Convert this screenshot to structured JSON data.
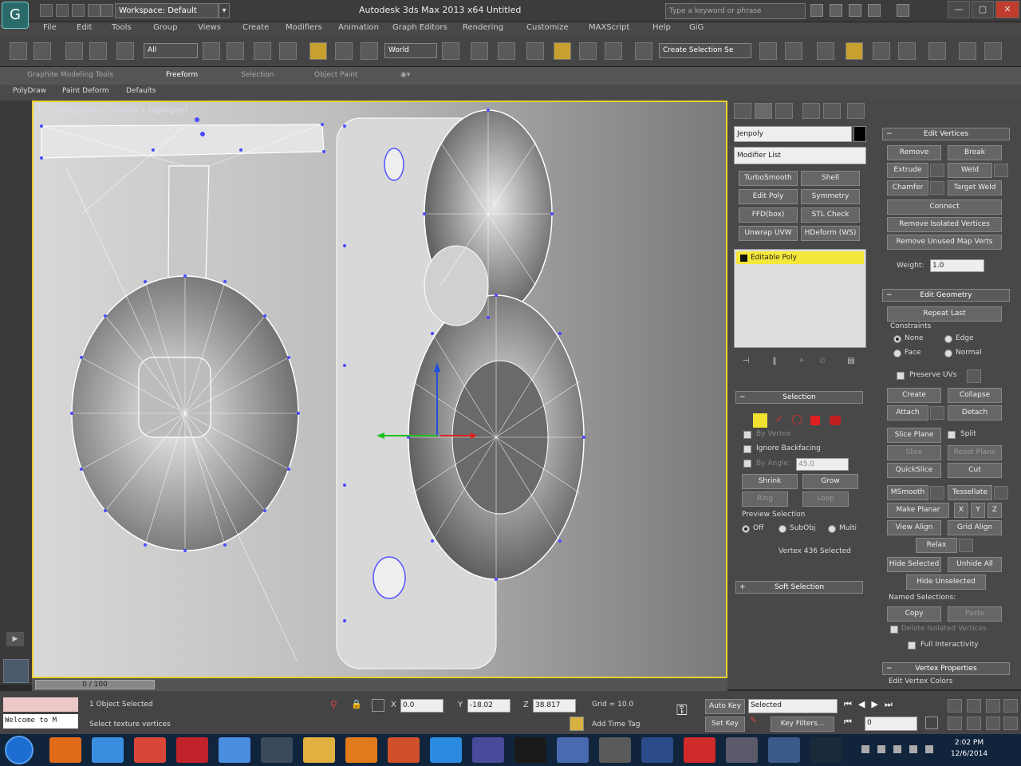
{
  "app": {
    "logo_glyph": "G",
    "workspace_label": "Workspace: Default",
    "title": "Autodesk 3ds Max 2013 x64      Untitled",
    "search_placeholder": "Type a keyword or phrase"
  },
  "window_controls": [
    "—",
    "▢",
    "✕"
  ],
  "menu": [
    "File",
    "Edit",
    "Tools",
    "Group",
    "Views",
    "Create",
    "Modifiers",
    "Animation",
    "Graph Editors",
    "Rendering",
    "Customize",
    "MAXScript",
    "Help",
    "GiG"
  ],
  "toolbar": {
    "filter": "All",
    "ref_coord": "World",
    "named_sel": "Create Selection Se"
  },
  "ribbon": {
    "tabs": [
      "Graphite Modeling Tools",
      "Freeform",
      "Selection",
      "Object Paint"
    ],
    "subtabs": [
      "PolyDraw",
      "Paint Deform",
      "Defaults"
    ]
  },
  "viewport": {
    "label": "[+] [Orthographic] [Smooth + Highlights]"
  },
  "command_panel": {
    "object_name": "Jenpoly",
    "modifier_list": "Modifier List",
    "modifier_buttons": [
      "TurboSmooth",
      "Shell",
      "Edit Poly",
      "Symmetry",
      "FFD(box)",
      "STL Check",
      "Unwrap UVW",
      "HDeform (WS)"
    ],
    "stack_item": "Editable Poly",
    "stack_icons": [
      "⊣",
      "‖",
      "✦",
      "⊘",
      "▤"
    ],
    "selection": {
      "header": "Selection",
      "by_vertex": "By Vertex",
      "ignore_backfacing": "Ignore Backfacing",
      "by_angle": "By Angle:",
      "by_angle_value": "45.0",
      "shrink": "Shrink",
      "grow": "Grow",
      "ring": "Ring",
      "loop": "Loop",
      "preview_header": "Preview Selection",
      "preview_off": "Off",
      "preview_subobj": "SubObj",
      "preview_multi": "Multi",
      "status": "Vertex 436 Selected"
    },
    "soft_selection": "Soft Selection",
    "edit_vertices": {
      "header": "Edit Vertices",
      "remove": "Remove",
      "break": "Break",
      "extrude": "Extrude",
      "weld": "Weld",
      "chamfer": "Chamfer",
      "target_weld": "Target Weld",
      "connect": "Connect",
      "remove_isolated": "Remove Isolated Vertices",
      "remove_unused": "Remove Unused Map Verts",
      "weight_label": "Weight:",
      "weight_value": "1.0"
    },
    "edit_geometry": {
      "header": "Edit Geometry",
      "repeat_last": "Repeat Last",
      "constraints": "Constraints",
      "none": "None",
      "edge": "Edge",
      "face": "Face",
      "normal": "Normal",
      "preserve_uvs": "Preserve UVs",
      "create": "Create",
      "collapse": "Collapse",
      "attach": "Attach",
      "detach": "Detach",
      "slice_plane": "Slice Plane",
      "split": "Split",
      "slice": "Slice",
      "reset_plane": "Reset Plane",
      "quickslice": "QuickSlice",
      "cut": "Cut",
      "msmooth": "MSmooth",
      "tessellate": "Tessellate",
      "make_planar": "Make Planar",
      "x": "X",
      "y": "Y",
      "z": "Z",
      "view_align": "View Align",
      "grid_align": "Grid Align",
      "relax": "Relax",
      "hide_selected": "Hide Selected",
      "unhide_all": "Unhide All",
      "hide_unselected": "Hide Unselected",
      "named_selections": "Named Selections:",
      "copy": "Copy",
      "paste": "Paste",
      "delete_isolated": "Delete Isolated Vertices",
      "full_interactivity": "Full Interactivity"
    },
    "vertex_properties": "Vertex Properties",
    "edit_vertex_colors": "Edit Vertex Colors"
  },
  "timeline": {
    "frame_label": "0 / 100"
  },
  "status": {
    "maxscript": "Welcome to M",
    "objects_selected": "1 Object Selected",
    "prompt": "Select texture vertices",
    "x_value": "0.0",
    "y_value": "-18.02",
    "z_value": "38.817",
    "grid": "Grid = 10.0",
    "add_time_tag": "Add Time Tag",
    "auto_key": "Auto Key",
    "set_key": "Set Key",
    "key_filter_value": "Selected",
    "key_filters": "Key Filters...",
    "frame_value": "0"
  },
  "clock": {
    "time": "2:02 PM",
    "date": "12/6/2014"
  },
  "taskbar_colors": [
    "#1c6ed0",
    "#e06a1a",
    "#3a8ee0",
    "#d8463a",
    "#c0242a",
    "#4a8ee0",
    "#3a4a5a",
    "#e0b040",
    "#e07a1a",
    "#d0502a",
    "#2a8ae0",
    "#4a4a9a",
    "#1a1a1a",
    "#4a6ab0",
    "#5a5a5a",
    "#2a4a8a",
    "#d02a2a",
    "#5a5a6a",
    "#3a5a8a",
    "#1a2a3a"
  ]
}
